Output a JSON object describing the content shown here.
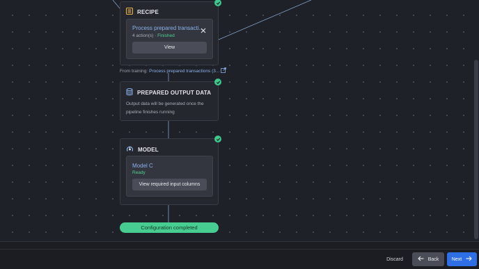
{
  "pipeline": {
    "recipe": {
      "title": "RECIPE",
      "icon": "list-icon",
      "card_title": "Process prepared transacti...",
      "card_actions": "4 action(s) · ",
      "card_status": "Finished",
      "view_label": "View"
    },
    "from_training": {
      "prefix": "From training: ",
      "link": "Process prepared transactions (3..."
    },
    "output": {
      "title": "PREPARED OUTPUT DATA",
      "icon": "database-icon",
      "description": "Output data will be generated once the pipeline finishes running"
    },
    "model": {
      "title": "MODEL",
      "icon": "model-icon",
      "card_title": "Model C",
      "card_status": "Ready",
      "columns_label": "View required input columns"
    },
    "config_status": "Configuration completed"
  },
  "footer": {
    "discard_label": "Discard",
    "back_label": "Back",
    "next_label": "Next"
  },
  "colors": {
    "background": "#1f2128",
    "accent_green": "#47cc92",
    "accent_blue": "#2f6fe6",
    "link": "#8ab2ea"
  }
}
